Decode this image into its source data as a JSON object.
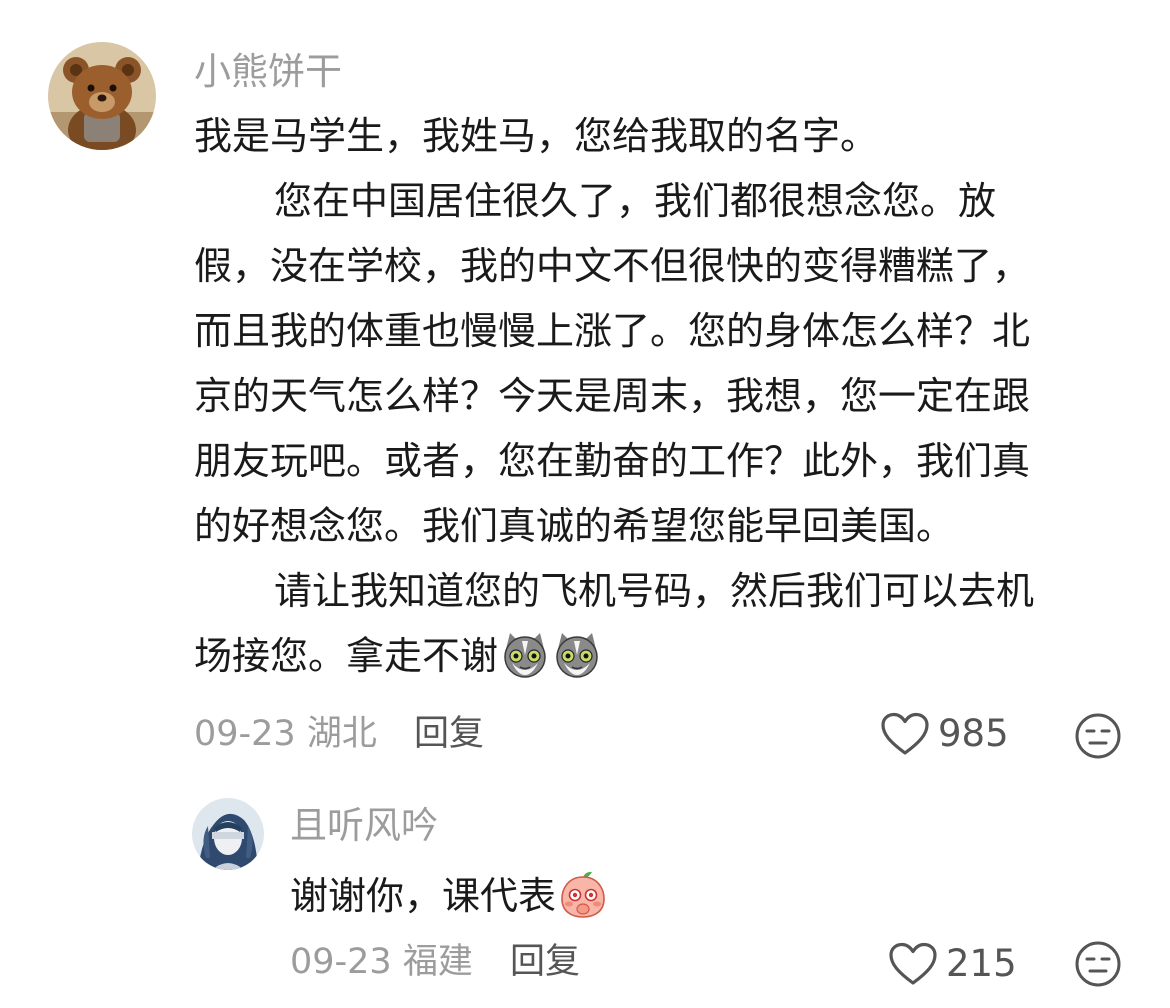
{
  "comments": [
    {
      "username": "小熊饼干",
      "avatar_icon": "teddy-bear-avatar",
      "paragraphs": [
        {
          "indent": false,
          "text": "我是马学生，我姓马，您给我取的名字。"
        },
        {
          "indent": true,
          "text": "您在中国居住很久了，我们都很想念您。放"
        },
        {
          "indent": false,
          "text": "假，没在学校，我的中文不但很快的变得糟糕了，"
        },
        {
          "indent": false,
          "text": "而且我的体重也慢慢上涨了。您的身体怎么样？北"
        },
        {
          "indent": false,
          "text": "京的天气怎么样？今天是周末，我想，您一定在跟"
        },
        {
          "indent": false,
          "text": "朋友玩吧。或者，您在勤奋的工作？此外，我们真"
        },
        {
          "indent": false,
          "text": "的好想念您。我们真诚的希望您能早回美国。"
        },
        {
          "indent": true,
          "text": "请让我知道您的飞机号码，然后我们可以去机"
        },
        {
          "indent": false,
          "text": "场接您。拿走不谢"
        }
      ],
      "stickers": [
        "cat-face-sticker",
        "cat-face-sticker"
      ],
      "date": "09-23",
      "location": "湖北",
      "reply_label": "回复",
      "likes": "985",
      "like_icon": "heart-outline-icon",
      "dislike_icon": "meh-face-icon"
    },
    {
      "username": "且听风吟",
      "avatar_icon": "anime-character-avatar",
      "text": "谢谢你，课代表",
      "sticker": "shy-peach-sticker",
      "date": "09-23",
      "location": "福建",
      "reply_label": "回复",
      "likes": "215",
      "like_icon": "heart-outline-icon",
      "dislike_icon": "meh-face-icon"
    }
  ],
  "colors": {
    "username": "#9c9c9c",
    "body_text": "#1a1a1a",
    "meta": "#9c9c9c",
    "action": "#555555"
  }
}
